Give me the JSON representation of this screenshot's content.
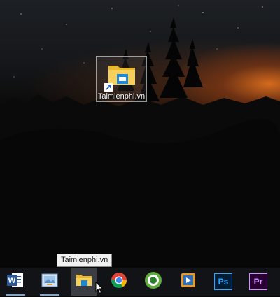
{
  "desktop": {
    "shortcut": {
      "label": "Taimienphi.vn",
      "icon": "file-explorer-icon",
      "overlay": "shortcut-arrow-icon"
    }
  },
  "tooltip": {
    "text": "Taimienphi.vn"
  },
  "taskbar": {
    "items": [
      {
        "name": "Microsoft Word",
        "icon": "word-icon",
        "running": true
      },
      {
        "name": "Image viewer",
        "icon": "image-viewer-icon",
        "running": true
      },
      {
        "name": "File Explorer",
        "icon": "file-explorer-icon",
        "running": false,
        "hovered": true
      },
      {
        "name": "Google Chrome",
        "icon": "chrome-icon",
        "running": false
      },
      {
        "name": "Coc Coc browser",
        "icon": "coccoc-icon",
        "running": false
      },
      {
        "name": "Video player",
        "icon": "video-player-icon",
        "running": false
      },
      {
        "name": "Adobe Photoshop",
        "icon": "photoshop-icon",
        "running": false,
        "text": "Ps"
      },
      {
        "name": "Adobe Premiere Pro",
        "icon": "premiere-icon",
        "running": false,
        "text": "Pr"
      }
    ]
  },
  "colors": {
    "taskbar": "#111316",
    "running_indicator": "#7aa7d6",
    "sunset": "#dc6e1e"
  }
}
